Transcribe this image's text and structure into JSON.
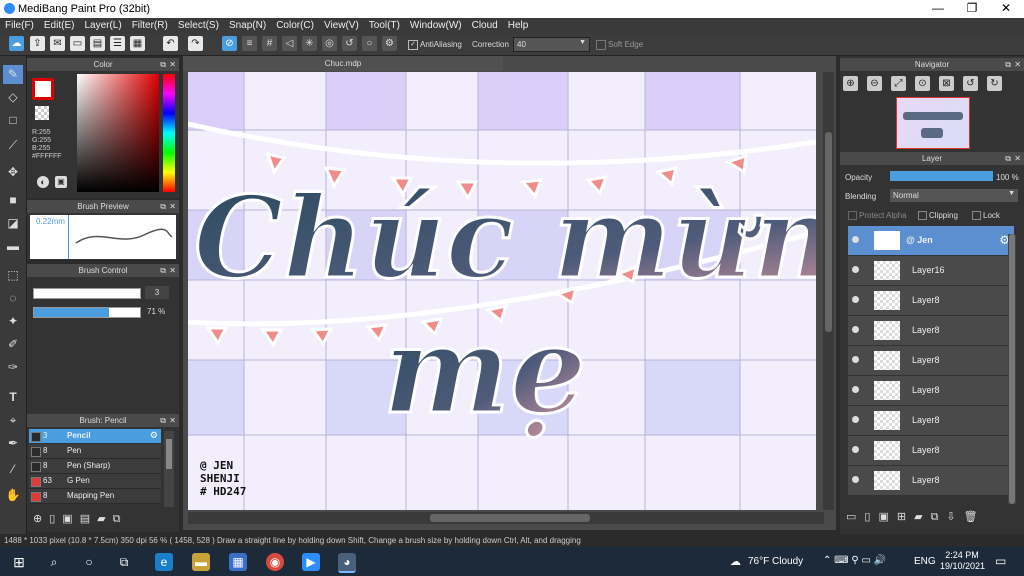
{
  "window": {
    "title": "MediBang Paint Pro (32bit)",
    "min": "—",
    "max": "❐",
    "close": "✕"
  },
  "menu": [
    "File(F)",
    "Edit(E)",
    "Layer(L)",
    "Filter(R)",
    "Select(S)",
    "Snap(N)",
    "Color(C)",
    "View(V)",
    "Tool(T)",
    "Window(W)",
    "Cloud",
    "Help"
  ],
  "toolbar": {
    "antialiasing": "AntiAliasing",
    "correction_label": "Correction",
    "correction_value": "40",
    "soft_edge": "Soft Edge"
  },
  "color_panel": {
    "title": "Color",
    "r": "R:255",
    "g": "G:255",
    "b": "B:255",
    "hex": "#FFFFFF"
  },
  "brush_preview": {
    "title": "Brush Preview",
    "size": "0.22mm"
  },
  "brush_control": {
    "title": "Brush Control",
    "size_value": "3",
    "opacity_value": "71",
    "opacity_unit": "%",
    "size_fraction": 0.95,
    "opacity_fraction": 0.71
  },
  "brush_list": {
    "title": "Brush: Pencil",
    "items": [
      {
        "size": "3",
        "name": "Pencil",
        "selected": true,
        "color": "#2a2a2a"
      },
      {
        "size": "8",
        "name": "Pen",
        "selected": false,
        "color": "#2a2a2a"
      },
      {
        "size": "8",
        "name": "Pen (Sharp)",
        "selected": false,
        "color": "#2a2a2a"
      },
      {
        "size": "63",
        "name": "G Pen",
        "selected": false,
        "color": "#e03a3a"
      },
      {
        "size": "8",
        "name": "Mapping Pen",
        "selected": false,
        "color": "#e03a3a"
      }
    ]
  },
  "document": {
    "tab": "Chuc.mdp"
  },
  "artwork": {
    "line1": "Chúc mừng",
    "line2": "mẹ",
    "signature": [
      "@ JEN",
      "SHENJI",
      "# HD247"
    ]
  },
  "navigator": {
    "title": "Navigator"
  },
  "layer_panel": {
    "title": "Layer",
    "opacity_label": "Opacity",
    "opacity_value": "100 %",
    "blending_label": "Blending",
    "blending_value": "Normal",
    "protect_alpha": "Protect Alpha",
    "clipping": "Clipping",
    "lock": "Lock",
    "layers": [
      {
        "name": "@ Jen",
        "selected": true
      },
      {
        "name": "Layer16",
        "selected": false
      },
      {
        "name": "Layer8",
        "selected": false
      },
      {
        "name": "Layer8",
        "selected": false
      },
      {
        "name": "Layer8",
        "selected": false
      },
      {
        "name": "Layer8",
        "selected": false
      },
      {
        "name": "Layer8",
        "selected": false
      },
      {
        "name": "Layer8",
        "selected": false
      },
      {
        "name": "Layer8",
        "selected": false
      }
    ]
  },
  "status": {
    "text": "1488 * 1033 pixel  (10.8 * 7.5cm)  350 dpi  56 %  ( 1458, 528 )  Draw a straight line by holding down Shift, Change a brush size by holding down Ctrl, Alt, and dragging"
  },
  "taskbar": {
    "weather": "76°F  Cloudy",
    "lang": "ENG",
    "time": "2:24 PM",
    "date": "19/10/2021"
  },
  "colors": {
    "accent": "#4a9ee0",
    "layer_selected": "#5b8fd0",
    "panel": "#333333"
  }
}
